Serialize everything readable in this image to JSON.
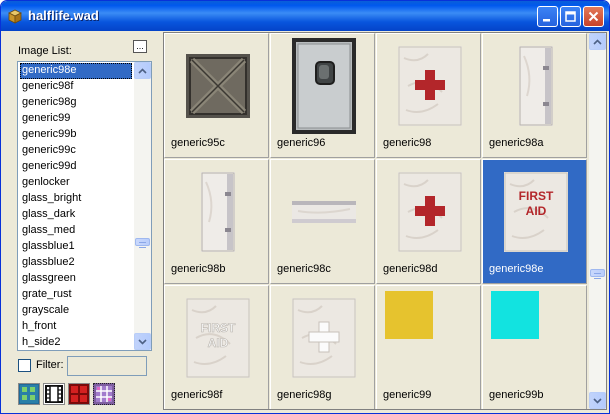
{
  "window": {
    "title": "halflife.wad"
  },
  "left_panel": {
    "image_list_label": "Image List:",
    "more_button": "...",
    "items": [
      "generic98e",
      "generic98f",
      "generic98g",
      "generic99",
      "generic99b",
      "generic99c",
      "generic99d",
      "genlocker",
      "glass_bright",
      "glass_dark",
      "glass_med",
      "glassblue1",
      "glassblue2",
      "glassgreen",
      "grate_rust",
      "grayscale",
      "h_front",
      "h_side2"
    ],
    "selected": "generic98e",
    "filter_label": "Filter:",
    "filter_value": ""
  },
  "grid": {
    "cells": [
      {
        "name": "generic95c",
        "icon": "crossed-metal-panel"
      },
      {
        "name": "generic96",
        "icon": "metal-door-window"
      },
      {
        "name": "generic98",
        "icon": "red-cross-panel"
      },
      {
        "name": "generic98a",
        "icon": "narrow-cabinet"
      },
      {
        "name": "generic98b",
        "icon": "narrow-cabinet"
      },
      {
        "name": "generic98c",
        "icon": "flat-strip"
      },
      {
        "name": "generic98d",
        "icon": "red-cross-panel"
      },
      {
        "name": "generic98e",
        "icon": "first-aid-red",
        "text": "FIRST AID"
      },
      {
        "name": "generic98f",
        "icon": "first-aid-white",
        "text": "FIRST AID"
      },
      {
        "name": "generic98g",
        "icon": "white-cross-panel"
      },
      {
        "name": "generic99",
        "icon": "yellow-swatch"
      },
      {
        "name": "generic99b",
        "icon": "cyan-swatch"
      }
    ],
    "selected": "generic98e"
  },
  "colors": {
    "selection": "#316ac5",
    "yellow": "#e6c32e",
    "cyan": "#12e3e0",
    "red_cross": "#b3262a"
  }
}
